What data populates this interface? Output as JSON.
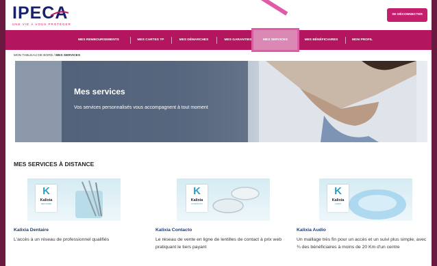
{
  "header": {
    "logo_text": "IPECA",
    "tagline": "UNE VIE À VOUS PROTÉGER",
    "logout_label": "SE DÉCONNECTER"
  },
  "nav": {
    "items": [
      {
        "label": "MES REMBOURSEMENTS"
      },
      {
        "label": "MES CARTES TP"
      },
      {
        "label": "MES DÉMARCHES"
      },
      {
        "label": "MES GARANTIES"
      },
      {
        "label": "MES SERVICES"
      },
      {
        "label": "MES BÉNÉFICIAIRES"
      },
      {
        "label": "MON PROFIL"
      }
    ],
    "active_index": 4
  },
  "breadcrumb": {
    "parent": "MON TABLEAU DE BORD",
    "separator": "/",
    "current": "MES SERVICES"
  },
  "hero": {
    "title": "Mes services",
    "subtitle": "Vos services personnalisés vous accompagnent à tout moment"
  },
  "section": {
    "title": "MES SERVICES À DISTANCE"
  },
  "cards": [
    {
      "brand": "Kalixia",
      "brand_sub": "DENTAIRE",
      "title": "Kalixia Dentaire",
      "text": "L'accès à un réseau de professionnel qualifiés",
      "icon": "dental-tools-image"
    },
    {
      "brand": "Kalixia",
      "brand_sub": "CONTACTO",
      "title": "Kalixia Contacto",
      "text": "Le réseau de vente en ligne de lentilles de contact à prix web pratiquant le tiers payant",
      "icon": "contact-lens-image"
    },
    {
      "brand": "Kalixia",
      "brand_sub": "AUDIO",
      "title": "Kalixia Audio",
      "text": "Un maillage très fin pour un accès et un suivi plus simple, avec ¾ des bénéficiaires à moins de 20 Km d'un centre",
      "icon": "hearing-aid-image"
    }
  ],
  "colors": {
    "brand_magenta": "#b3165e",
    "logo_navy": "#18226b",
    "highlight_pink": "#e05aa7",
    "card_title_blue": "#1b3a78"
  }
}
